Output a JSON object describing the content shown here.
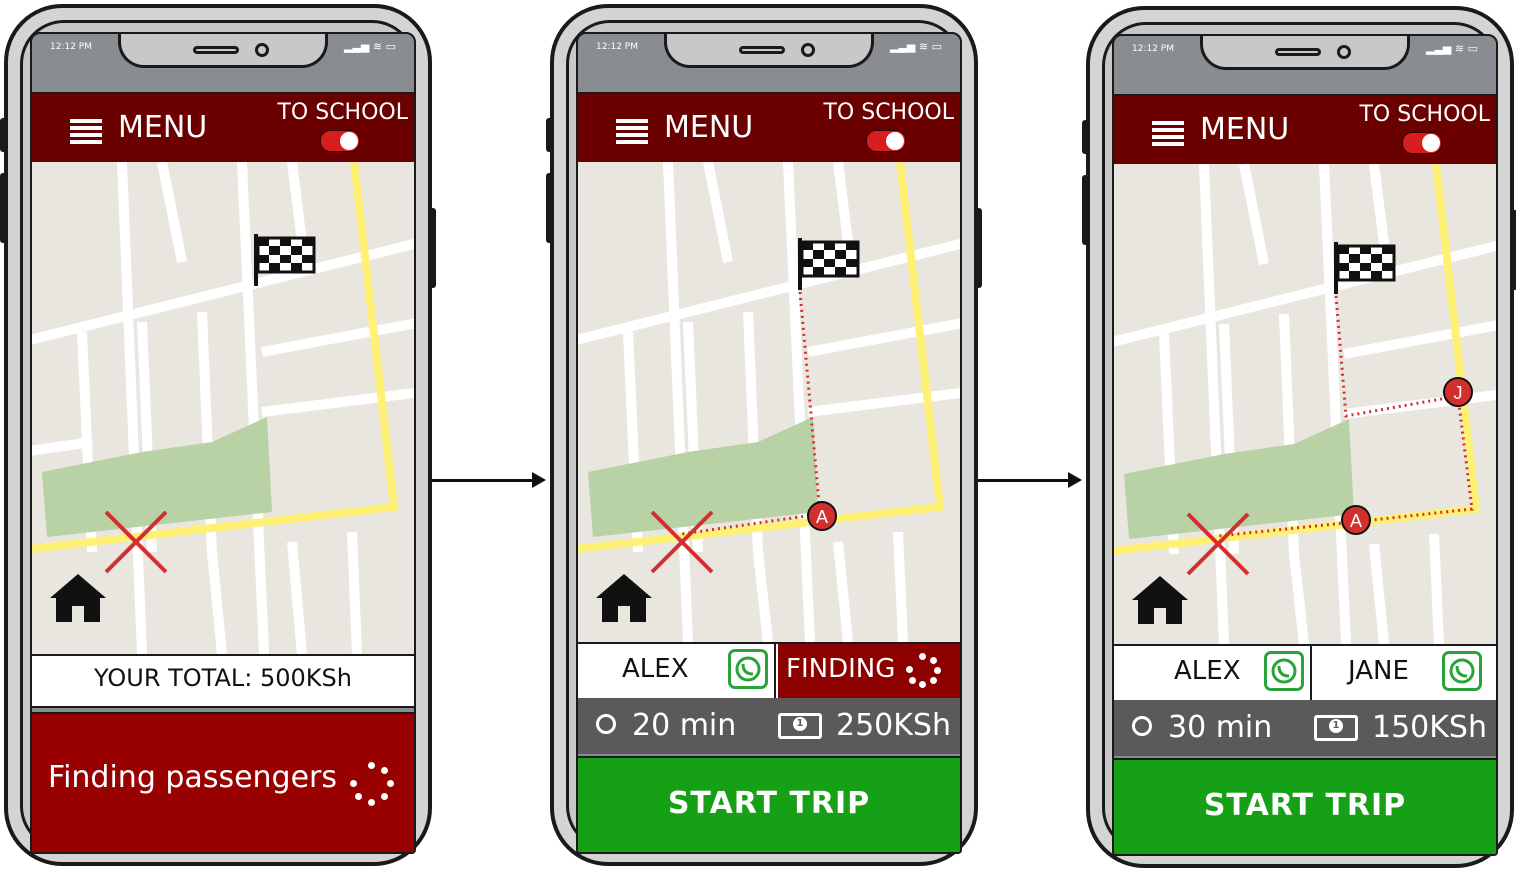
{
  "phones": [
    {
      "status": {
        "time": "12:12 PM"
      },
      "header": {
        "menu_label": "MENU",
        "toggle_label": "TO SCHOOL"
      },
      "total": {
        "label": "YOUR TOTAL: 500KSh"
      },
      "panel": {
        "label": "Finding passengers"
      }
    },
    {
      "status": {
        "time": "12:12 PM"
      },
      "header": {
        "menu_label": "MENU",
        "toggle_label": "TO SCHOOL"
      },
      "markers": [
        "A"
      ],
      "passengers": [
        {
          "name": "ALEX"
        },
        {
          "name": "FINDING"
        }
      ],
      "trip": {
        "duration": "20 min",
        "price": "250KSh"
      },
      "start_label": "START TRIP"
    },
    {
      "status": {
        "time": "12:12 PM"
      },
      "header": {
        "menu_label": "MENU",
        "toggle_label": "TO SCHOOL"
      },
      "markers": [
        "A",
        "J"
      ],
      "passengers": [
        {
          "name": "ALEX"
        },
        {
          "name": "JANE"
        }
      ],
      "trip": {
        "duration": "30 min",
        "price": "150KSh"
      },
      "start_label": "START TRIP"
    }
  ],
  "colors": {
    "header": "#6b0000",
    "finding": "#990000",
    "start": "#16a016",
    "info_bar": "#5a5a5a",
    "route": "#fff176",
    "marker": "#d32f2f",
    "whatsapp": "#2aa33b"
  },
  "icons": [
    "menu-icon",
    "toggle-switch",
    "finish-flag-icon",
    "home-icon",
    "cancel-x-icon",
    "whatsapp-icon",
    "clock-icon",
    "money-icon",
    "loading-spinner-icon"
  ]
}
